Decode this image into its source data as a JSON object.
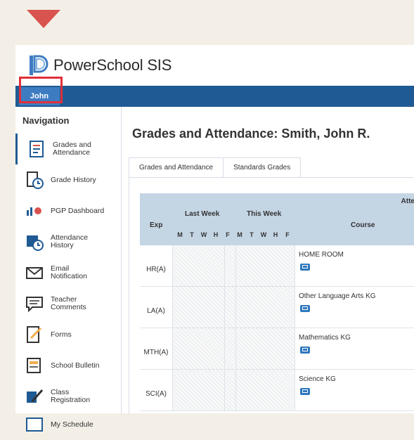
{
  "app": {
    "title": "PowerSchool SIS"
  },
  "header": {
    "user_tab": "John"
  },
  "nav": {
    "title": "Navigation",
    "items": [
      {
        "label": "Grades and Attendance",
        "icon": "grades-attendance-icon"
      },
      {
        "label": "Grade History",
        "icon": "grade-history-icon"
      },
      {
        "label": "PGP Dashboard",
        "icon": "dashboard-icon"
      },
      {
        "label": "Attendance History",
        "icon": "attendance-history-icon"
      },
      {
        "label": "Email Notification",
        "icon": "email-icon"
      },
      {
        "label": "Teacher Comments",
        "icon": "comments-icon"
      },
      {
        "label": "Forms",
        "icon": "forms-icon"
      },
      {
        "label": "School Bulletin",
        "icon": "bulletin-icon"
      },
      {
        "label": "Class Registration",
        "icon": "registration-icon"
      },
      {
        "label": "My Schedule",
        "icon": "schedule-icon"
      }
    ]
  },
  "main": {
    "title": "Grades and Attendance: Smith, John R.",
    "tabs": [
      "Grades and Attendance",
      "Standards Grades"
    ]
  },
  "table": {
    "attendance_header": "Atte",
    "exp_header": "Exp",
    "last_week": "Last Week",
    "this_week": "This Week",
    "course_header": "Course",
    "days": [
      "M",
      "T",
      "W",
      "H",
      "F",
      "M",
      "T",
      "W",
      "H",
      "F"
    ],
    "rows": [
      {
        "exp": "HR(A)",
        "course": "HOME ROOM"
      },
      {
        "exp": "LA(A)",
        "course": "Other Language Arts KG"
      },
      {
        "exp": "MTH(A)",
        "course": "Mathematics KG"
      },
      {
        "exp": "SCI(A)",
        "course": "Science KG"
      }
    ]
  },
  "colors": {
    "brand_bar": "#1f5a94",
    "user_tab": "#3e7cc2",
    "highlight": "#e0303a",
    "table_head": "#c4d5e4"
  }
}
